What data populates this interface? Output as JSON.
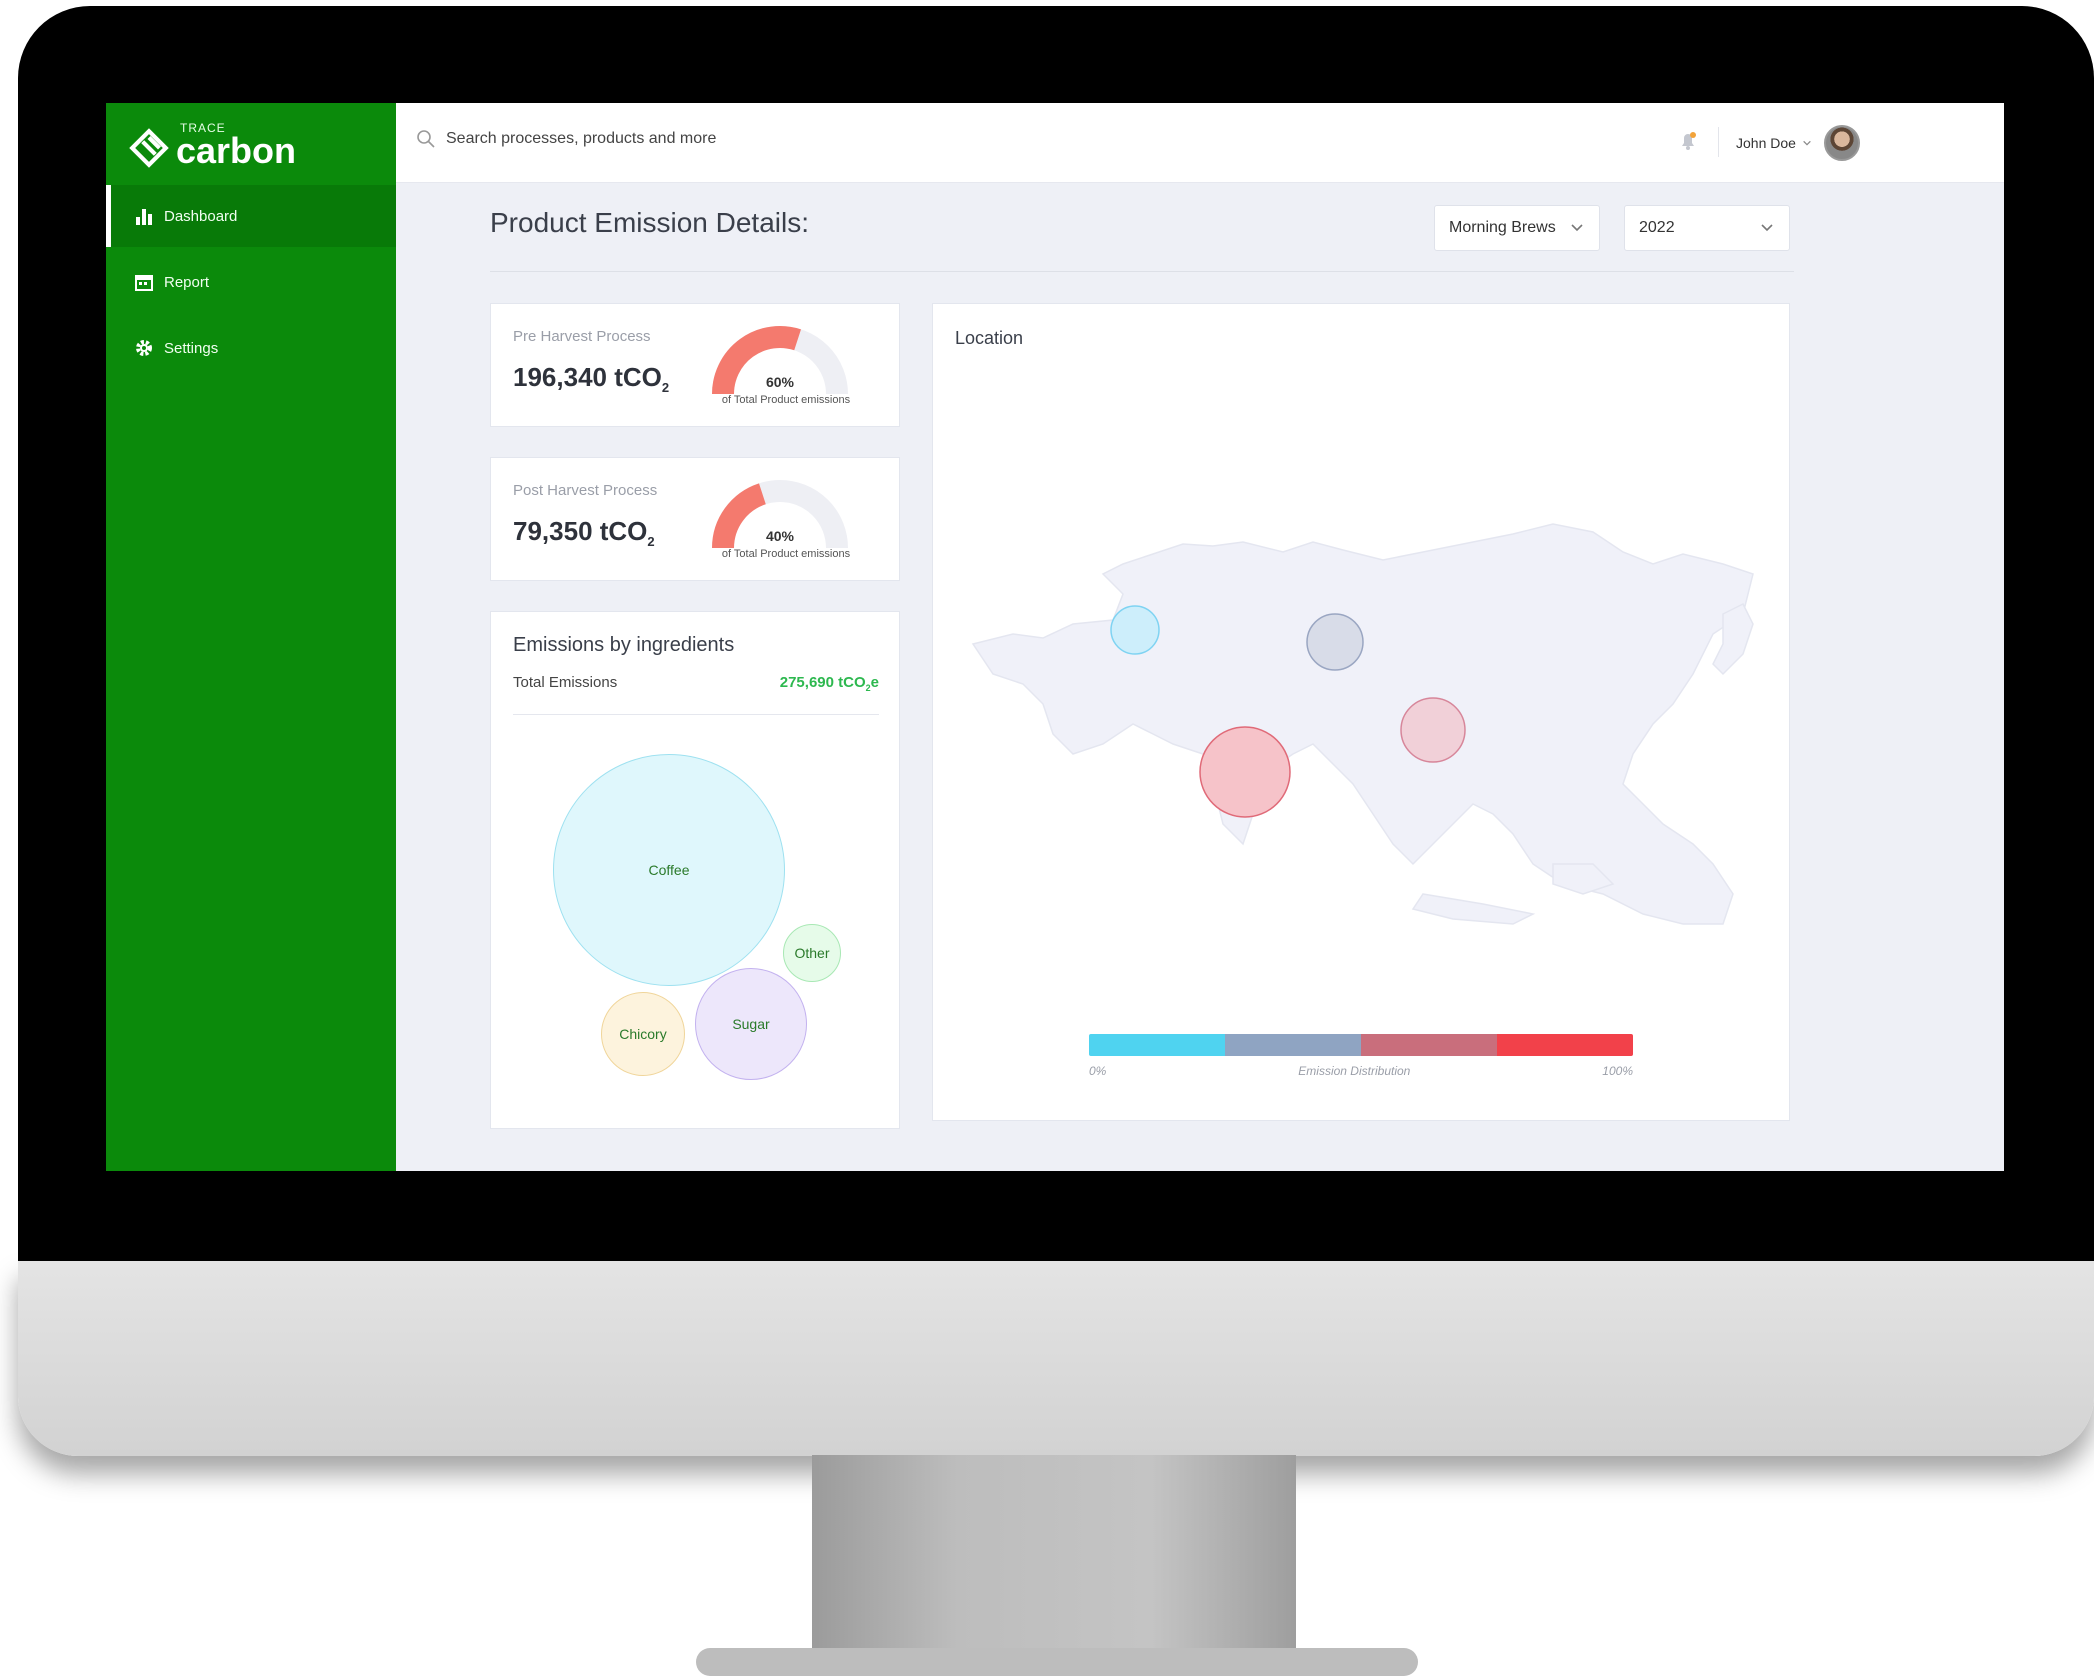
{
  "brand": {
    "small": "TRACE",
    "name": "carbon"
  },
  "sidebar": {
    "items": [
      {
        "label": "Dashboard",
        "icon": "bar-chart-icon",
        "active": true
      },
      {
        "label": "Report",
        "icon": "calendar-icon",
        "active": false
      },
      {
        "label": "Settings",
        "icon": "gear-icon",
        "active": false
      }
    ]
  },
  "topbar": {
    "search_placeholder": "Search processes, products and more",
    "user_name": "John Doe"
  },
  "page": {
    "title": "Product Emission Details:",
    "product_select": "Morning Brews",
    "year_select": "2022"
  },
  "pre_harvest": {
    "label": "Pre Harvest Process",
    "value": "196,340 tCO",
    "unit_sub": "2",
    "percent_text": "60%",
    "percent": 0.6,
    "caption": "of Total Product emissions"
  },
  "post_harvest": {
    "label": "Post Harvest Process",
    "value": "79,350 tCO",
    "unit_sub": "2",
    "percent_text": "40%",
    "percent": 0.4,
    "caption": "of Total Product emissions"
  },
  "ingredients": {
    "title": "Emissions by ingredients",
    "total_label": "Total Emissions",
    "total_value": "275,690 tCO",
    "total_sub": "2",
    "total_suffix": "e",
    "bubbles": [
      {
        "label": "Coffee",
        "color": "#dff7fc"
      },
      {
        "label": "Other",
        "color": "#e6fbe9"
      },
      {
        "label": "Chicory",
        "color": "#fdf3dd"
      },
      {
        "label": "Sugar",
        "color": "#ede7fb"
      }
    ]
  },
  "location": {
    "title": "Location",
    "legend_min": "0%",
    "legend_label": "Emission Distribution",
    "legend_max": "100%",
    "legend_colors": [
      "#4fd3f0",
      "#8fa4c2",
      "#c96e7c",
      "#f2414a"
    ]
  }
}
